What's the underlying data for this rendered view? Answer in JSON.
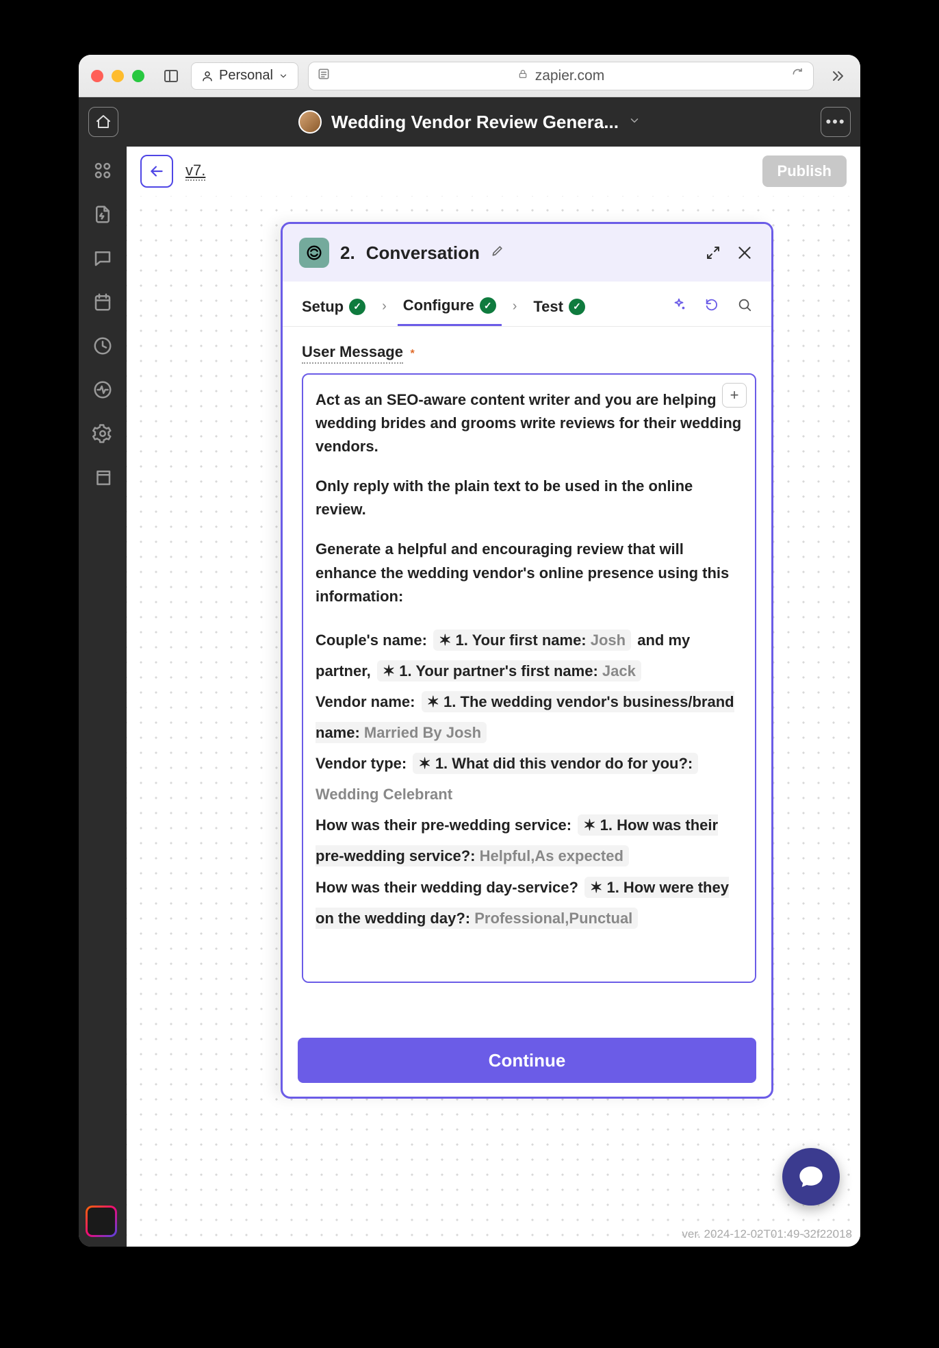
{
  "browser": {
    "profile": "Personal",
    "url_host": "zapier.com"
  },
  "header": {
    "title": "Wedding Vendor Review Genera..."
  },
  "content": {
    "version_label": "v7.",
    "publish_label": "Publish"
  },
  "step": {
    "number": "2.",
    "title": "Conversation",
    "tabs": {
      "setup": "Setup",
      "configure": "Configure",
      "test": "Test"
    },
    "field_label": "User Message",
    "required_mark": "*",
    "message": {
      "p1": "Act as an SEO-aware content writer and you are helping wedding brides and grooms write reviews for their wedding vendors.",
      "p2": "Only reply with the plain text to be used in the online review.",
      "p3": "Generate a helpful and encouraging review that will enhance the wedding vendor's online presence using this information:",
      "couple_prefix": "Couple's name:",
      "couple_mid": " and my partner,",
      "vendor_name_prefix": "Vendor name:",
      "vendor_type_prefix": "Vendor type:",
      "vendor_type_value": "Wedding Celebrant",
      "pre_service_prefix": "How was their pre-wedding service:",
      "day_service_prefix": "How was their wedding day-service?",
      "pills": {
        "first_name": {
          "label": "1. Your first name:",
          "value": "Josh"
        },
        "partner_name": {
          "label": "1. Your partner's first name:",
          "value": "Jack"
        },
        "vendor_name": {
          "label": "1. The wedding vendor's business/brand name:",
          "value": "Married By Josh"
        },
        "vendor_type": {
          "label": "1. What did this vendor do for you?:"
        },
        "pre_service": {
          "label": "1. How was their pre-wedding service?:",
          "value": "Helpful,As expected"
        },
        "day_service": {
          "label": "1. How were they on the wedding day?:",
          "value": "Professional,Punctual"
        }
      }
    },
    "continue_label": "Continue"
  },
  "footer": {
    "version_stamp": "ver. 2024-12-02T01:49-32f22018"
  }
}
